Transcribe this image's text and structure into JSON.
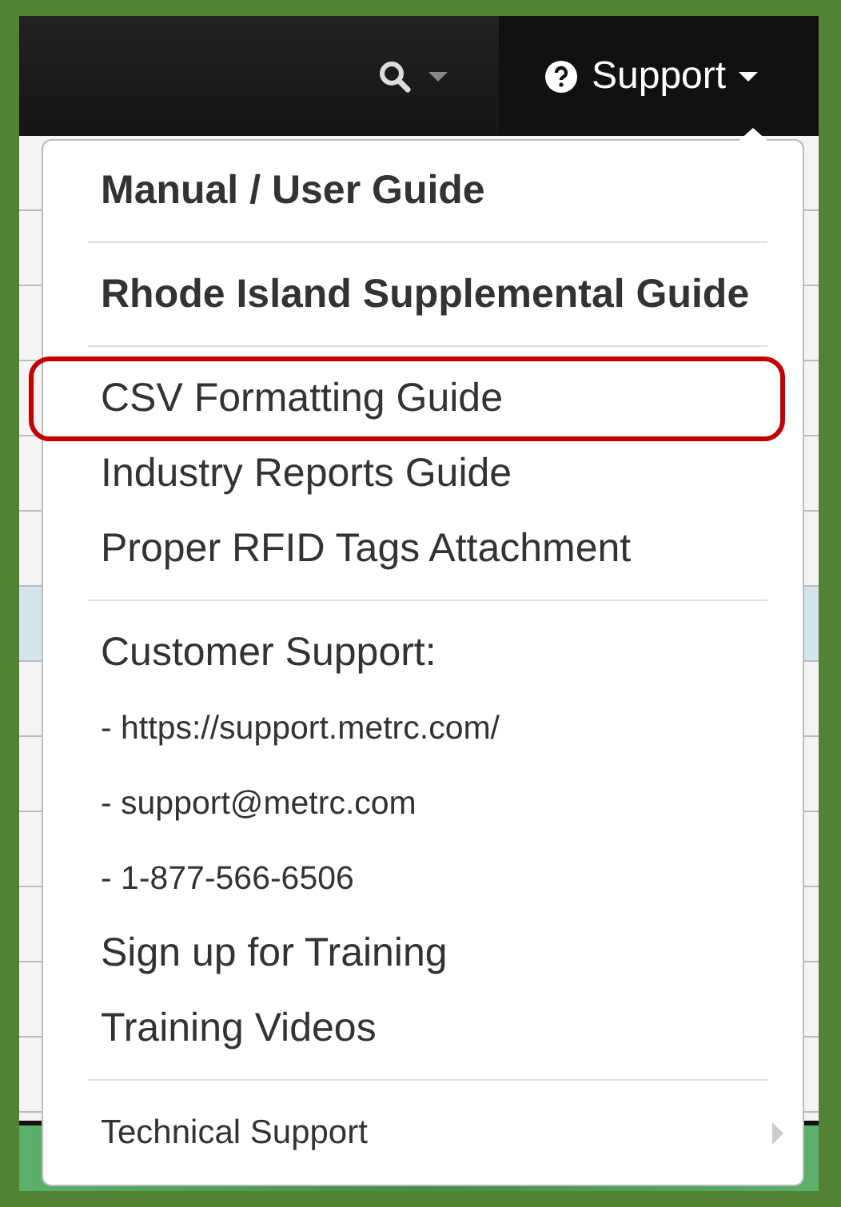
{
  "navbar": {
    "search": {
      "has_caret": true
    },
    "support": {
      "label": "Support",
      "open": true
    }
  },
  "menu": [
    {
      "kind": "header",
      "label": "Manual / User Guide",
      "highlighted": false
    },
    {
      "kind": "divider"
    },
    {
      "kind": "header",
      "label": "Rhode Island Supplemental Guide",
      "highlighted": false
    },
    {
      "kind": "divider"
    },
    {
      "kind": "link",
      "label": "CSV Formatting Guide",
      "highlighted": true
    },
    {
      "kind": "link",
      "label": "Industry Reports Guide",
      "highlighted": false
    },
    {
      "kind": "link",
      "label": "Proper RFID Tags Attachment",
      "highlighted": false
    },
    {
      "kind": "divider"
    },
    {
      "kind": "text",
      "label": "Customer Support:",
      "highlighted": false
    },
    {
      "kind": "small",
      "label": "- https://support.metrc.com/",
      "highlighted": false
    },
    {
      "kind": "small",
      "label": "- support@metrc.com",
      "highlighted": false
    },
    {
      "kind": "small",
      "label": "- 1-877-566-6506",
      "highlighted": false
    },
    {
      "kind": "link",
      "label": "Sign up for Training",
      "highlighted": false
    },
    {
      "kind": "link",
      "label": "Training Videos",
      "highlighted": false
    },
    {
      "kind": "divider"
    },
    {
      "kind": "submenu",
      "label": "Technical Support",
      "highlighted": false
    }
  ]
}
